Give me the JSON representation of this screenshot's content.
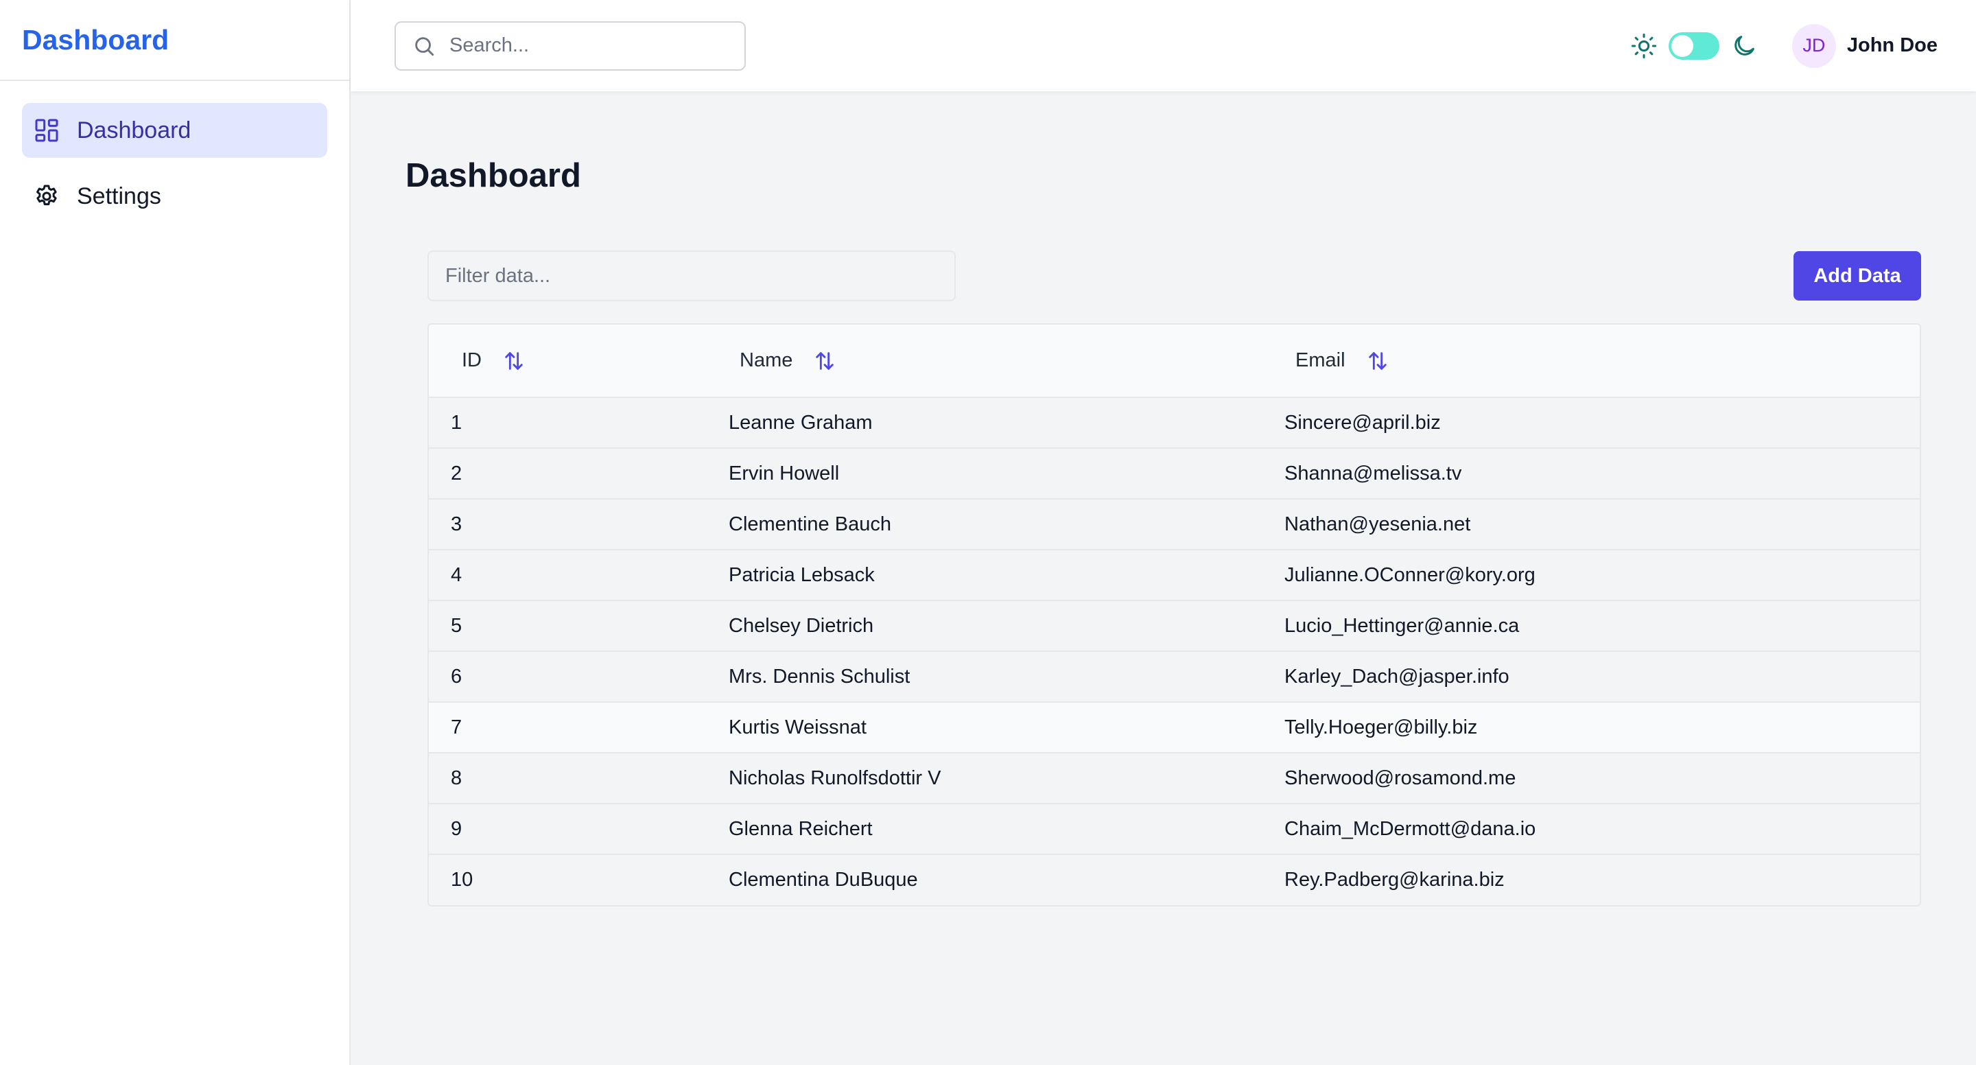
{
  "sidebar": {
    "brand": "Dashboard",
    "items": [
      {
        "label": "Dashboard",
        "icon": "dashboard-grid-icon",
        "active": true
      },
      {
        "label": "Settings",
        "icon": "gear-icon",
        "active": false
      }
    ]
  },
  "topbar": {
    "search_placeholder": "Search...",
    "theme_toggle": {
      "light_icon": "sun-icon",
      "dark_icon": "moon-icon",
      "on": true
    },
    "user": {
      "initials": "JD",
      "name": "John Doe"
    }
  },
  "main": {
    "title": "Dashboard",
    "filter_placeholder": "Filter data...",
    "add_button": "Add Data",
    "table": {
      "columns": [
        "ID",
        "Name",
        "Email"
      ],
      "rows": [
        [
          "1",
          "Leanne Graham",
          "Sincere@april.biz"
        ],
        [
          "2",
          "Ervin Howell",
          "Shanna@melissa.tv"
        ],
        [
          "3",
          "Clementine Bauch",
          "Nathan@yesenia.net"
        ],
        [
          "4",
          "Patricia Lebsack",
          "Julianne.OConner@kory.org"
        ],
        [
          "5",
          "Chelsey Dietrich",
          "Lucio_Hettinger@annie.ca"
        ],
        [
          "6",
          "Mrs. Dennis Schulist",
          "Karley_Dach@jasper.info"
        ],
        [
          "7",
          "Kurtis Weissnat",
          "Telly.Hoeger@billy.biz"
        ],
        [
          "8",
          "Nicholas Runolfsdottir V",
          "Sherwood@rosamond.me"
        ],
        [
          "9",
          "Glenna Reichert",
          "Chaim_McDermott@dana.io"
        ],
        [
          "10",
          "Clementina DuBuque",
          "Rey.Padberg@karina.biz"
        ]
      ]
    }
  },
  "colors": {
    "brand": "#2563eb",
    "accent": "#4f46e5",
    "active_nav_bg": "#e0e7ff",
    "toggle_on": "#5eead4",
    "avatar_bg": "#f3e8ff"
  }
}
